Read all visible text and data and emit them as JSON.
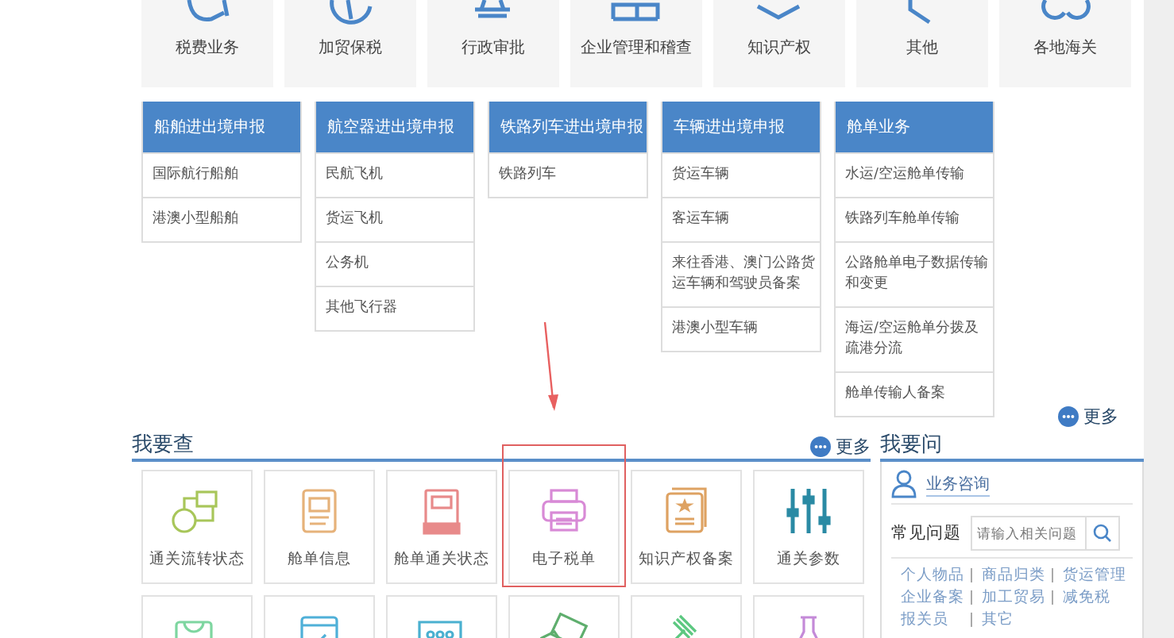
{
  "top_tiles": [
    {
      "label": "税费业务"
    },
    {
      "label": "加贸保税"
    },
    {
      "label": "行政审批"
    },
    {
      "label": "企业管理和稽查"
    },
    {
      "label": "知识产权"
    },
    {
      "label": "其他"
    },
    {
      "label": "各地海关"
    }
  ],
  "menus": [
    {
      "title": "船舶进出境申报",
      "items": [
        "国际航行船舶",
        "港澳小型船舶"
      ]
    },
    {
      "title": "航空器进出境申报",
      "items": [
        "民航飞机",
        "货运飞机",
        "公务机",
        "其他飞行器"
      ]
    },
    {
      "title": "铁路列车进出境申报",
      "items": [
        "铁路列车"
      ]
    },
    {
      "title": "车辆进出境申报",
      "items": [
        "货运车辆",
        "客运车辆",
        "来往香港、澳门公路货运车辆和驾驶员备案",
        "港澳小型车辆"
      ]
    },
    {
      "title": "舱单业务",
      "items": [
        "水运/空运舱单传输",
        "铁路列车舱单传输",
        "公路舱单电子数据传输和变更",
        "海运/空运舱单分拨及疏港分流",
        "舱单传输人备案"
      ]
    }
  ],
  "query": {
    "title": "我要查",
    "more": "更多",
    "tiles": [
      {
        "label": "通关流转状态",
        "color": "#a8c65a",
        "highlighted": false
      },
      {
        "label": "舱单信息",
        "color": "#e6b27a",
        "highlighted": false
      },
      {
        "label": "舱单通关状态",
        "color": "#e88a8a",
        "highlighted": false
      },
      {
        "label": "电子税单",
        "color": "#d88ad6",
        "highlighted": true
      },
      {
        "label": "知识产权备案",
        "color": "#dea262",
        "highlighted": false
      },
      {
        "label": "通关参数",
        "color": "#2a8aa4",
        "highlighted": false
      }
    ],
    "icon_tiles": [
      {
        "color": "#7ed6a0"
      },
      {
        "color": "#4fb0d8"
      },
      {
        "color": "#4ab0d0"
      },
      {
        "color": "#5fae6e"
      },
      {
        "color": "#5cc880"
      },
      {
        "color": "#c48ad8"
      }
    ]
  },
  "ask": {
    "more": "更多",
    "title": "我要问",
    "consult": "业务咨询",
    "faq_label": "常见问题",
    "search": {
      "placeholder": "请输入相关问题"
    },
    "links": [
      [
        "个人物品",
        "商品归类",
        "货运管理"
      ],
      [
        "企业备案",
        "加工贸易",
        "减免税"
      ],
      [
        "报关员",
        "其它"
      ]
    ]
  }
}
